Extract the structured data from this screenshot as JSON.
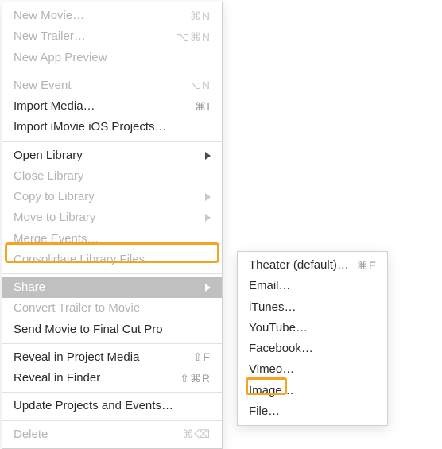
{
  "main_menu": {
    "new_movie": "New Movie…",
    "new_movie_sc": "⌘N",
    "new_trailer": "New Trailer…",
    "new_trailer_sc": "⌥⌘N",
    "new_app_preview": "New App Preview",
    "new_event": "New Event",
    "new_event_sc": "⌥N",
    "import_media": "Import Media…",
    "import_media_sc": "⌘I",
    "import_imovie_ios": "Import iMovie iOS Projects…",
    "open_library": "Open Library",
    "close_library": "Close Library",
    "copy_to_library": "Copy to Library",
    "move_to_library": "Move to Library",
    "merge_events": "Merge Events…",
    "consolidate": "Consolidate Library Files…",
    "share": "Share",
    "convert_trailer": "Convert Trailer to Movie",
    "send_fcp": "Send Movie to Final Cut Pro",
    "reveal_project": "Reveal in Project Media",
    "reveal_project_sc": "⇧F",
    "reveal_finder": "Reveal in Finder",
    "reveal_finder_sc": "⇧⌘R",
    "update_projects": "Update Projects and Events…",
    "delete": "Delete",
    "delete_sc": "⌘⌫"
  },
  "share_submenu": {
    "theater": "Theater (default)…",
    "theater_sc": "⌘E",
    "email": "Email…",
    "itunes": "iTunes…",
    "youtube": "YouTube…",
    "facebook": "Facebook…",
    "vimeo": "Vimeo…",
    "image": "Image…",
    "file": "File…"
  }
}
